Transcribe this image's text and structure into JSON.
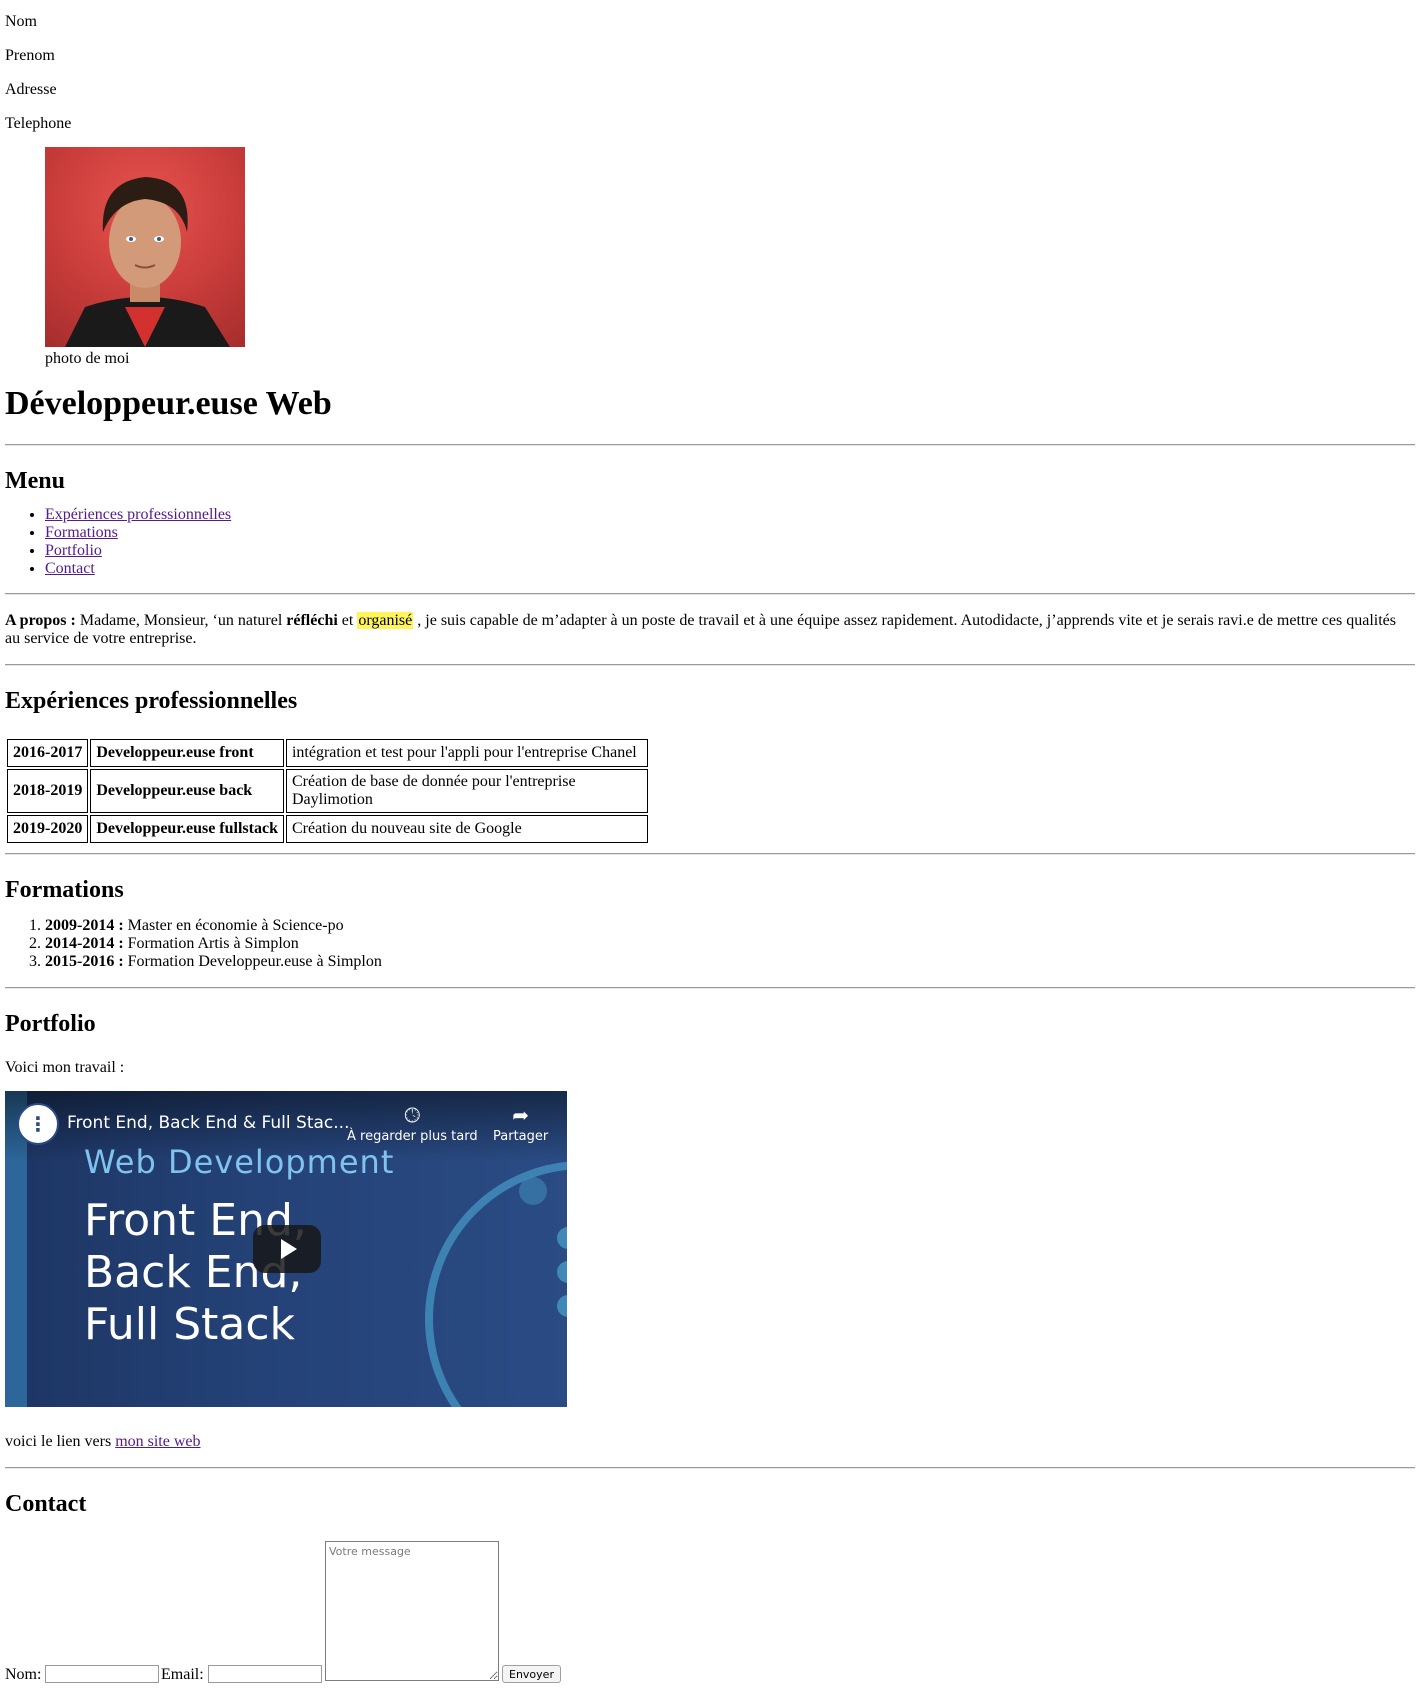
{
  "header_info": {
    "nom": "Nom",
    "prenom": "Prenom",
    "adresse": "Adresse",
    "telephone": "Telephone"
  },
  "photo": {
    "caption": "photo de moi"
  },
  "title": "Développeur.euse Web",
  "menu": {
    "heading": "Menu",
    "items": [
      {
        "label": "Expériences professionnelles"
      },
      {
        "label": "Formations"
      },
      {
        "label": "Portfolio"
      },
      {
        "label": "Contact"
      }
    ]
  },
  "apropos": {
    "label": "A propos :",
    "text1": " Madame, Monsieur, ‘un naturel ",
    "bold1": "réfléchi",
    "text2": " et ",
    "highlight": "organisé",
    "text3": " , je suis capable de m’adapter à un poste de travail et à une équipe assez rapidement. Autodidacte, j’apprends vite et je serais ravi.e de mettre ces qualités au service de votre entreprise."
  },
  "experiences": {
    "heading": "Expériences professionnelles",
    "rows": [
      {
        "year": "2016-2017",
        "role": "Developpeur.euse front",
        "desc": "intégration et test pour l'appli pour l'entreprise Chanel"
      },
      {
        "year": "2018-2019",
        "role": "Developpeur.euse back",
        "desc": "Création de base de donnée pour l'entreprise Daylimotion"
      },
      {
        "year": "2019-2020",
        "role": "Developpeur.euse fullstack",
        "desc": "Création du nouveau site de Google"
      }
    ]
  },
  "formations": {
    "heading": "Formations",
    "items": [
      {
        "years": "2009-2014 :",
        "text": " Master en économie à Science-po"
      },
      {
        "years": "2014-2014 :",
        "text": " Formation Artis à Simplon"
      },
      {
        "years": "2015-2016 :",
        "text": " Formation Developpeur.euse à Simplon"
      }
    ]
  },
  "portfolio": {
    "heading": "Portfolio",
    "intro": "Voici mon travail :",
    "video": {
      "title": "Front End, Back End & Full Stac...",
      "watch_later": "À regarder plus tard",
      "share": "Partager",
      "headline": "Web Development",
      "line1": "Front End,",
      "line2": "Back End,",
      "line3": "Full Stack"
    },
    "link_prefix": "voici le lien vers ",
    "link_label": "mon site web"
  },
  "contact": {
    "heading": "Contact",
    "nom_label": "Nom:",
    "email_label": "Email:",
    "message_placeholder": "Votre message",
    "submit_label": "Envoyer"
  }
}
